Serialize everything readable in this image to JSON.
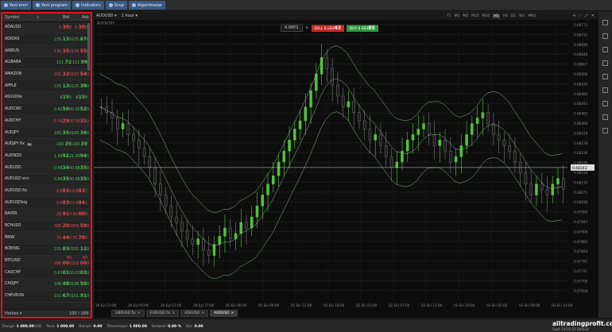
{
  "toolbar": {
    "buttons": [
      {
        "label": "Yeni emri",
        "icon": "plus-icon"
      },
      {
        "label": "Yeni program",
        "icon": "document-icon"
      },
      {
        "label": "Indicators",
        "icon": "chart-icon"
      },
      {
        "label": "Grup",
        "icon": "group-icon"
      },
      {
        "label": "Algoritmalar",
        "icon": "gear-icon"
      }
    ]
  },
  "watchlist": {
    "headers": {
      "symbol": "Symbol",
      "bid": "Bid",
      "ask": "Ask"
    },
    "rows": [
      {
        "name": "ADAUSD",
        "bid": "0.398",
        "ask": "0.398",
        "dir": "dn"
      },
      {
        "name": "ADIDAS",
        "bid": "235.130",
        "ask": "235.670",
        "dir": "up"
      },
      {
        "name": "AIRBUS",
        "bid": "130.350",
        "ask": "130.550",
        "dir": "dn"
      },
      {
        "name": "ALIBABA",
        "bid": "111.72",
        "ask": "111.99",
        "dir": "up"
      },
      {
        "name": "AMAZON",
        "bid": "161.320",
        "ask": "167.540",
        "dir": "dn"
      },
      {
        "name": "APPLE",
        "bid": "225.130",
        "ask": "225.380",
        "dir": "up"
      },
      {
        "name": "ASX200e",
        "bid": "8155",
        "ask": "8158",
        "dir": "up"
      },
      {
        "name": "AUDCAD",
        "bid": "0.92500",
        "ask": "0.92520",
        "dir": "up"
      },
      {
        "name": "AUDCHF",
        "bid": "0.56290",
        "ask": "0.56310",
        "dir": "dn"
      },
      {
        "name": "AUDJPY",
        "bid": "100.350",
        "ask": "100.360",
        "dir": "up"
      },
      {
        "name": "AUDJPY fix",
        "badge": "fix",
        "bid": "100.35",
        "ask": "100.39",
        "dir": "up"
      },
      {
        "name": "AUDNZD",
        "bid": "1.09922",
        "ask": "1.09945",
        "dir": "up"
      },
      {
        "name": "AUDUSD",
        "bid": "0.68340",
        "ask": "0.68350",
        "dir": "up"
      },
      {
        "name": "AUDUSD ecn",
        "bid": "0.68350",
        "ask": "0.68350",
        "dir": "up"
      },
      {
        "name": "AUDUSD fix",
        "bid": "0.6834",
        "ask": "0.6837",
        "dir": "dn"
      },
      {
        "name": "AUDUSDbig",
        "bid": "0.6830",
        "ask": "0.6841",
        "dir": "dn"
      },
      {
        "name": "BAYER",
        "bid": "29.910",
        "ask": "30.000",
        "dir": "dn"
      },
      {
        "name": "BCHUSD",
        "bid": "306.200",
        "ask": "306.580",
        "dir": "dn"
      },
      {
        "name": "BMW",
        "bid": "75.440",
        "ask": "75.780",
        "dir": "dn"
      },
      {
        "name": "BOEING",
        "bid": "155.830",
        "ask": "155.120",
        "dir": "up"
      },
      {
        "name": "BTCUSD",
        "bid": "60 296.000",
        "ask": "60 318.000",
        "dir": "dn"
      },
      {
        "name": "CADCHF",
        "bid": "0.63010",
        "ask": "0.63030",
        "dir": "up"
      },
      {
        "name": "CADJPY",
        "bid": "108.480",
        "ask": "108.500",
        "dir": "up"
      },
      {
        "name": "CHEVRON",
        "bid": "151.670",
        "ask": "151.910",
        "dir": "up"
      }
    ],
    "footer": {
      "label": "Herkes",
      "count": "100 / 189"
    }
  },
  "chart": {
    "symbol_select": "AUDUSD",
    "timeframe_select": "1 hour",
    "symbol_label": "AUDUSD",
    "timeframes": [
      "T1",
      "M1",
      "M5",
      "M15",
      "M30",
      "H1",
      "H4",
      "D1",
      "W1",
      "MN1"
    ],
    "selected_tf": "H1",
    "lot": "0.0001",
    "sell_label": "SELL",
    "sell_price": "0.683",
    "sell_big": "43",
    "buy_label": "BUY",
    "buy_price": "0.683",
    "buy_big": "85",
    "current_price": "0.68343",
    "yticks": [
      "0.68773",
      "0.68732",
      "0.68690",
      "0.68649",
      "0.68607",
      "0.68566",
      "0.68525",
      "0.68484",
      "0.68443",
      "0.68401",
      "0.68360",
      "0.68319",
      "0.68278",
      "0.68236",
      "0.68195",
      "0.68154",
      "0.68112",
      "0.68071",
      "0.68030",
      "0.67989",
      "0.67947",
      "0.67906",
      "0.67865",
      "0.67824",
      "0.67782",
      "0.67741",
      "0.67700",
      "0.67658"
    ],
    "xticks": [
      "30 Eyl 22:00",
      "30 Eyl 05:00",
      "30 Eyl 11:00",
      "30 Eyl 17:00",
      "01 Eki 00:00",
      "01 Eki 06:00",
      "01 Eki 12:00",
      "01 Eki 18:00",
      "02 Eki 01:00",
      "02 Eki 07:00",
      "02 Eki 13:00",
      "02 Eki 20:00",
      "03 Eki 02:00",
      "03 Eki 08:00",
      "03 Eki 14:00"
    ]
  },
  "tabs": [
    {
      "label": "GBPUSD fix",
      "active": false
    },
    {
      "label": "EURUSD fix",
      "active": false
    },
    {
      "label": "ADAUSD",
      "active": false
    },
    {
      "label": "AUDUSD",
      "active": true
    }
  ],
  "status": {
    "items": [
      {
        "label": "Denge:",
        "value": "1 000.00",
        "unit": "USD"
      },
      {
        "label": "Para:",
        "value": "1 000.00",
        "unit": ""
      },
      {
        "label": "Bakiye:",
        "value": "0.00",
        "unit": ""
      },
      {
        "label": "Özsermaye:",
        "value": "1 000.00",
        "unit": ""
      },
      {
        "label": "Serbest:",
        "value": "0.00 %",
        "unit": ""
      },
      {
        "label": "Kar:",
        "value": "0.00",
        "unit": ""
      }
    ],
    "brand": "alltradingprofit.com",
    "zone": "Saat: 14:51:22  Default"
  }
}
